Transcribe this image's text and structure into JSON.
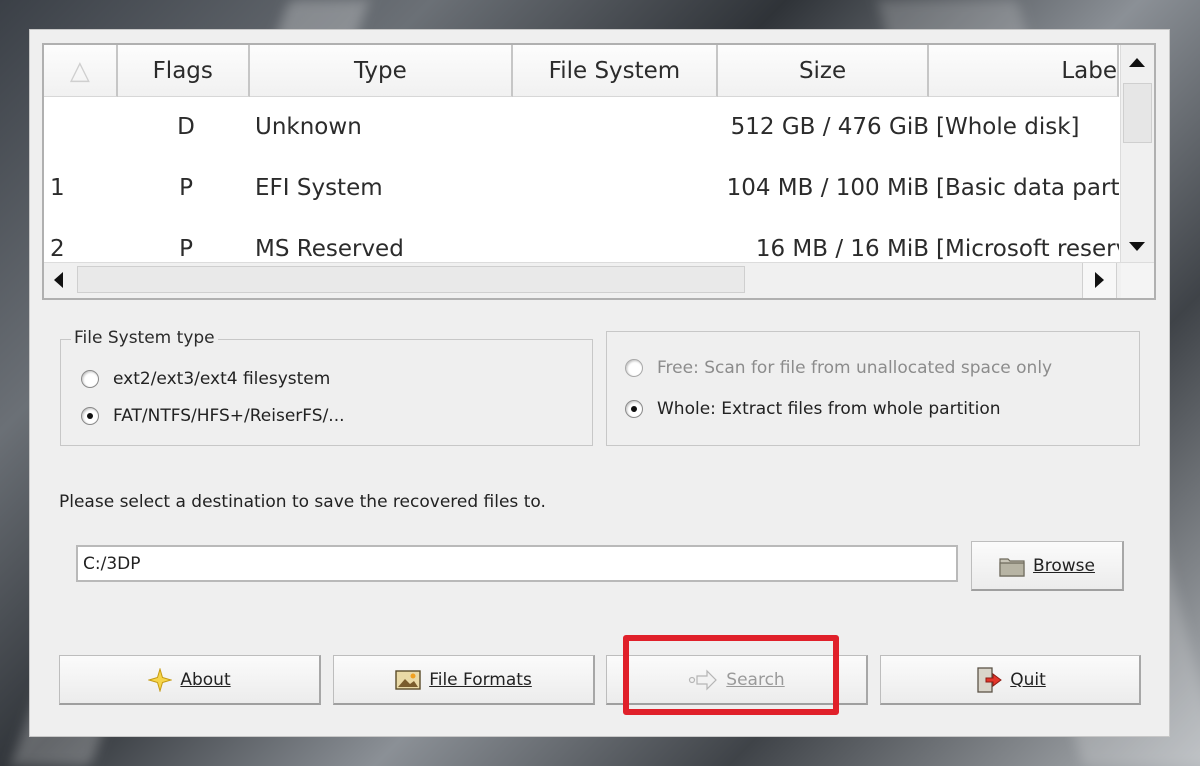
{
  "table": {
    "sort_glyph": "△",
    "columns": [
      "Flags",
      "Type",
      "File System",
      "Size",
      "Labe"
    ],
    "rows": [
      {
        "num": "",
        "flag": "D",
        "type": "Unknown",
        "size": "512 GB / 476 GiB",
        "label": "[Whole disk]"
      },
      {
        "num": "1",
        "flag": "P",
        "type": "EFI System",
        "size": "104 MB / 100 MiB",
        "label": "[Basic data partiti"
      },
      {
        "num": "2",
        "flag": "P",
        "type": "MS Reserved",
        "size": "16 MB / 16 MiB",
        "label": "[Microsoft reserv"
      }
    ]
  },
  "fs_group": {
    "legend": "File System type",
    "options": [
      {
        "label": "ext2/ext3/ext4 filesystem",
        "checked": false
      },
      {
        "label": "FAT/NTFS/HFS+/ReiserFS/...",
        "checked": true
      }
    ]
  },
  "scan_group": {
    "options": [
      {
        "label": "Free: Scan for file from unallocated space only",
        "checked": false,
        "disabled": true
      },
      {
        "label": "Whole: Extract files from whole partition",
        "checked": true,
        "disabled": false
      }
    ]
  },
  "destination": {
    "prompt": "Please select a destination to save the recovered files to.",
    "value": "C:/3DP",
    "browse_label": "Browse"
  },
  "buttons": {
    "about": "About",
    "file_formats": "File Formats",
    "search": "Search",
    "quit": "Quit"
  },
  "icons": [
    "sort-indicator-icon",
    "scroll-up-icon",
    "scroll-down-icon",
    "scroll-left-icon",
    "scroll-right-icon",
    "folder-icon",
    "star-icon",
    "image-icon",
    "search-arrow-icon",
    "exit-door-icon"
  ],
  "colors": {
    "highlight": "#e0202a",
    "dialog_bg": "#efefef"
  }
}
